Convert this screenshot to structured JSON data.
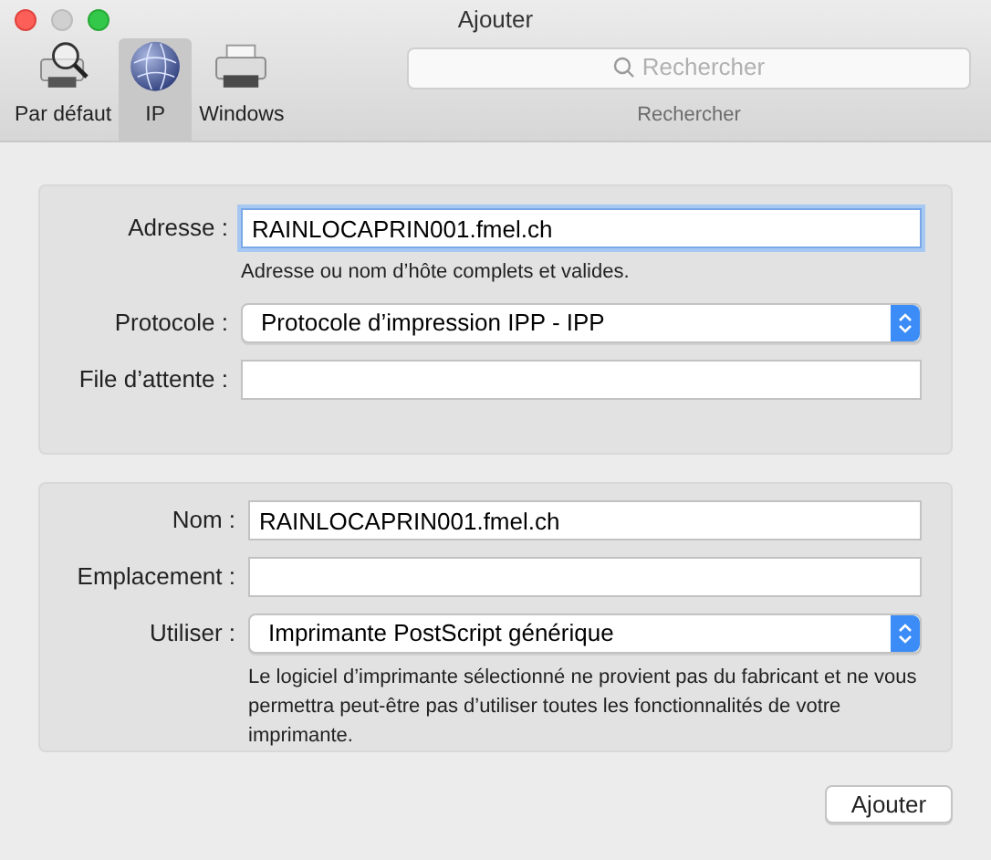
{
  "window": {
    "title": "Ajouter"
  },
  "tabs": [
    {
      "label": "Par défaut",
      "kind": "default",
      "selected": false
    },
    {
      "label": "IP",
      "kind": "ip",
      "selected": true
    },
    {
      "label": "Windows",
      "kind": "windows",
      "selected": false
    }
  ],
  "search": {
    "placeholder": "Rechercher",
    "label": "Rechercher"
  },
  "connection": [
    {
      "kind": "field",
      "label": "Adresse :",
      "value": "RAINLOCAPRIN001.fmel.ch",
      "focused": true,
      "hint": "Adresse ou nom d’hôte complets et valides."
    },
    {
      "kind": "select",
      "label": "Protocole :",
      "value": "Protocole d’impression IPP - IPP"
    },
    {
      "kind": "field",
      "label": "File d’attente :",
      "focused": false
    }
  ],
  "printer": [
    {
      "kind": "field",
      "label": "Nom :",
      "value": "RAINLOCAPRIN001.fmel.ch",
      "focused": false
    },
    {
      "kind": "field",
      "label": "Emplacement :",
      "focused": false
    },
    {
      "kind": "select",
      "label": "Utiliser :",
      "value": "Imprimante PostScript générique",
      "hint": "Le logiciel d’imprimante sélectionné ne provient pas du fabricant et ne vous permettra peut-être pas d’utiliser toutes les fonctionnalités de votre imprimante."
    }
  ],
  "buttons": [
    "Ajouter"
  ]
}
